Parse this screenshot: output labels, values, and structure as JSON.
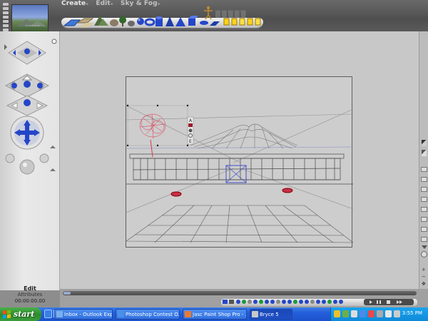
{
  "menu": {
    "create": "Create",
    "edit": "Edit",
    "sky_fog": "Sky & Fog"
  },
  "preview": {
    "caption": "~~~~~"
  },
  "left_panel": {
    "mode_label": "Edit",
    "sub_label": "Attributes",
    "timecode": "00:00:00.00"
  },
  "taskbar": {
    "start_label": "start",
    "tasks": [
      {
        "label": "Inbox - Outlook Express"
      },
      {
        "label": "Photoshop Contest O..."
      },
      {
        "label": "Jasc Paint Shop Pro - ..."
      },
      {
        "label": "Bryce 5"
      }
    ],
    "clock": "3:55 PM"
  },
  "selection_tools": [
    "A",
    "E"
  ],
  "colors": {
    "accent_blue": "#2546c8",
    "tree_red": "#e0304a",
    "taskbar_blue": "#245edb",
    "start_green": "#2e8b2e"
  }
}
